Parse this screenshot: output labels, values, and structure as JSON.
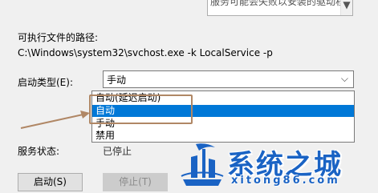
{
  "description": {
    "text": "服务可能会失败以安装的驱动程序无法正常运行，并使"
  },
  "path": {
    "label": "可执行文件的路径:",
    "value": "C:\\Windows\\system32\\svchost.exe -k LocalService -p"
  },
  "startup_type": {
    "label": "启动类型(E):",
    "selected": "手动",
    "options": [
      "自动(延迟启动)",
      "自动",
      "手动",
      "禁用"
    ],
    "highlighted_index": 1
  },
  "service_status": {
    "label": "服务状态:",
    "value": "已停止"
  },
  "buttons": {
    "start": "启动(S)",
    "stop": "停止(T)"
  },
  "watermark": {
    "title": "系统之城",
    "url": "xitong86.com"
  },
  "colors": {
    "selection": "#0078d7",
    "annotation": "#b08765",
    "watermark": "#1a63c4"
  }
}
